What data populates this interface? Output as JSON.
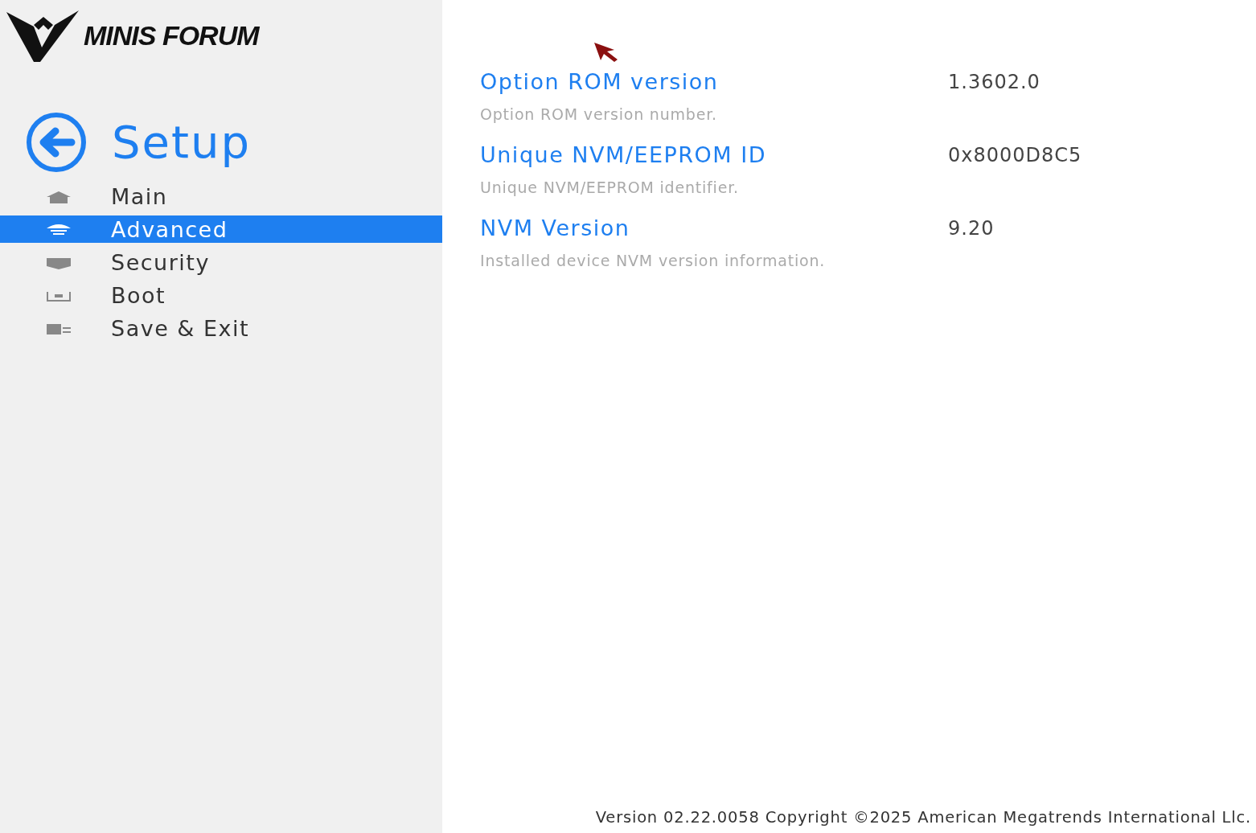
{
  "logo": {
    "text": "MINIS FORUM"
  },
  "sidebar": {
    "title": "Setup",
    "items": [
      {
        "label": "Main",
        "selected": false
      },
      {
        "label": "Advanced",
        "selected": true
      },
      {
        "label": "Security",
        "selected": false
      },
      {
        "label": "Boot",
        "selected": false
      },
      {
        "label": "Save & Exit",
        "selected": false
      }
    ]
  },
  "settings": [
    {
      "label": "Option ROM version",
      "description": "Option ROM version number.",
      "value": "1.3602.0"
    },
    {
      "label": "Unique NVM/EEPROM ID",
      "description": "Unique NVM/EEPROM identifier.",
      "value": "0x8000D8C5"
    },
    {
      "label": "NVM Version",
      "description": "Installed device NVM version information.",
      "value": "9.20"
    }
  ],
  "status_bar": "Version 02.22.0058 Copyright ©2025 American Megatrends International Llc."
}
